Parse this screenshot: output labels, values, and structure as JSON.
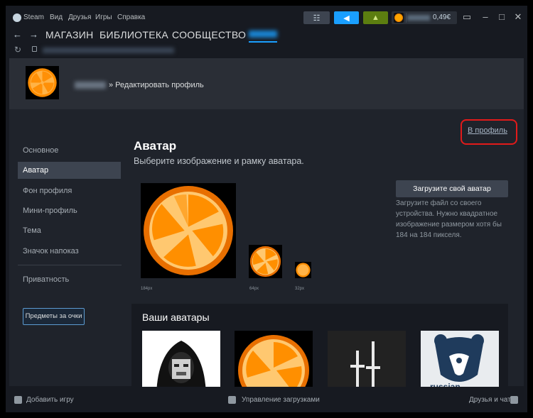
{
  "titlebar": {
    "app_name": "Steam",
    "menu": [
      "Вид",
      "Друзья",
      "Игры",
      "Справка"
    ],
    "balance": "0,49€",
    "colors": {
      "notify_blue": "#1a9fff",
      "notify_green": "#5c7e10",
      "dark_btn": "#3d4450"
    }
  },
  "nav": {
    "back_icon": "arrow-left-icon",
    "forward_icon": "arrow-right-icon",
    "items": [
      "МАГАЗИН",
      "БИБЛИОТЕКА",
      "СООБЩЕСТВО"
    ]
  },
  "header": {
    "breadcrumb": "» Редактировать профиль"
  },
  "sidebar": {
    "items": [
      "Основное",
      "Аватар",
      "Фон профиля",
      "Мини-профиль",
      "Тема",
      "Значок напоказ"
    ],
    "active_index": 1,
    "privacy": "Приватность",
    "items_button": "Предметы за очки"
  },
  "main": {
    "to_profile_link": "В профиль",
    "title": "Аватар",
    "subtitle": "Выберите изображение и рамку аватара.",
    "sizes": [
      "184px",
      "64px",
      "32px"
    ],
    "upload_button": "Загрузите свой аватар",
    "upload_description": "Загрузите файл со своего устройства. Нужно квадратное изображение размером хотя бы 184 на 184 пикселя.",
    "your_avatars_title": "Ваши аватары",
    "your_avatars_caption": "russian"
  },
  "bottombar": {
    "add_game": "Добавить игру",
    "downloads": "Управление загрузками",
    "friends": "Друзья и чат"
  }
}
